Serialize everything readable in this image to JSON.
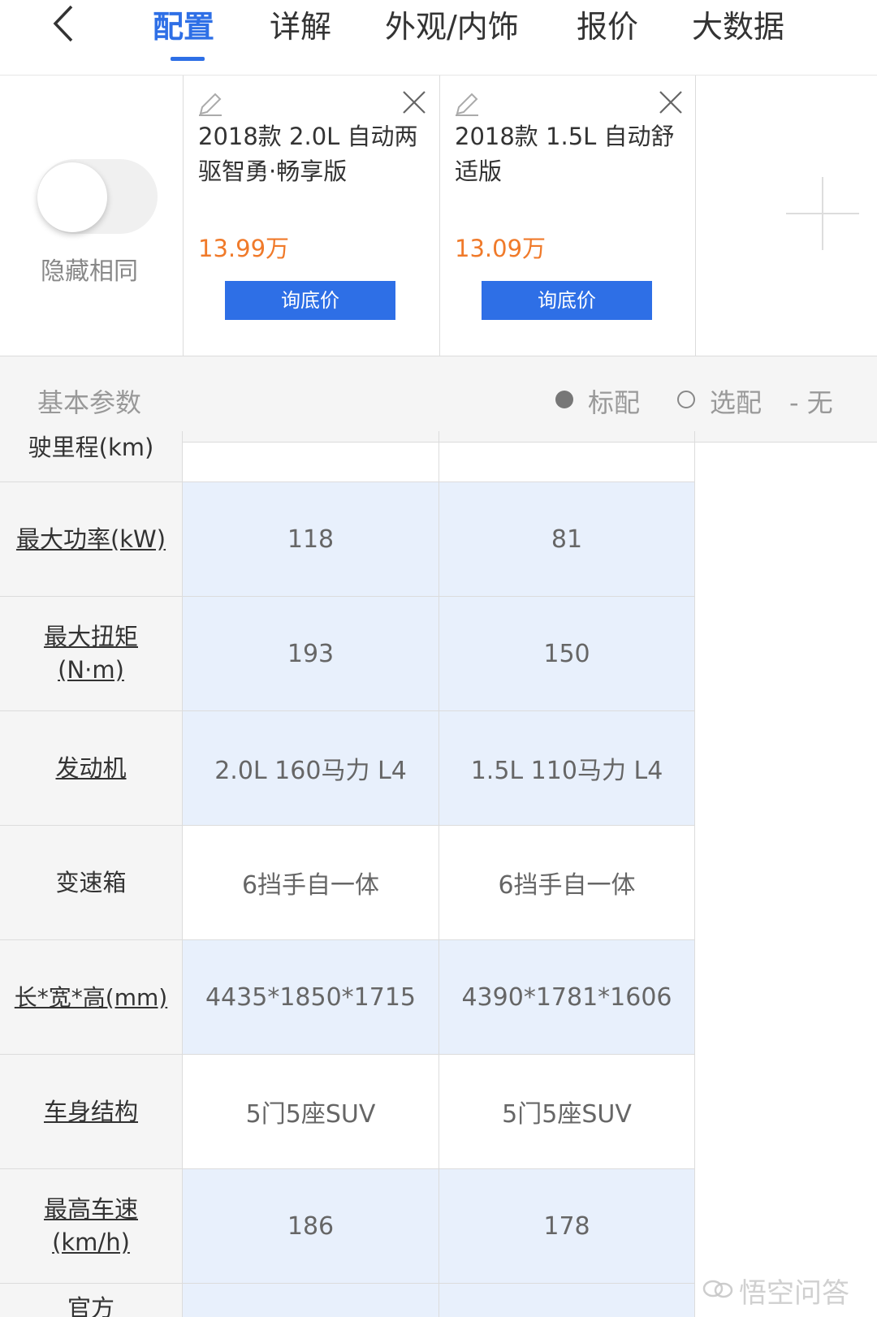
{
  "nav": {
    "tabs": [
      {
        "label": "配置"
      },
      {
        "label": "详解"
      },
      {
        "label": "外观/内饰"
      },
      {
        "label": "报价"
      },
      {
        "label": "大数据"
      }
    ]
  },
  "header": {
    "hide_same_label": "隐藏相同",
    "cars": [
      {
        "name": "2018款 2.0L 自动两驱智勇·畅享版",
        "price": "13.99万",
        "ask_label": "询底价"
      },
      {
        "name": "2018款 1.5L 自动舒适版",
        "price": "13.09万",
        "ask_label": "询底价"
      }
    ]
  },
  "section": {
    "title": "基本参数",
    "legend": {
      "standard": "标配",
      "optional": "选配",
      "none": "- 无"
    }
  },
  "table": {
    "rows": [
      {
        "label": "驶里程(km)",
        "values": [
          "",
          ""
        ]
      },
      {
        "label": "最大功率(kW)",
        "values": [
          "118",
          "81"
        ]
      },
      {
        "label": "最大扭矩(N·m)",
        "values": [
          "193",
          "150"
        ]
      },
      {
        "label": "发动机",
        "values": [
          "2.0L 160马力 L4",
          "1.5L 110马力 L4"
        ]
      },
      {
        "label": "变速箱",
        "values": [
          "6挡手自一体",
          "6挡手自一体"
        ]
      },
      {
        "label": "长*宽*高(mm)",
        "values": [
          "4435*1850*1715",
          "4390*1781*1606"
        ]
      },
      {
        "label": "车身结构",
        "values": [
          "5门5座SUV",
          "5门5座SUV"
        ]
      },
      {
        "label": "最高车速(km/h)",
        "values": [
          "186",
          "178"
        ]
      },
      {
        "label": "官方",
        "values": [
          "",
          ""
        ]
      }
    ]
  },
  "watermark": "悟空问答",
  "colors": {
    "accent": "#2e6fe6",
    "price": "#f07a2a",
    "highlight_row": "#e8f0fc"
  }
}
